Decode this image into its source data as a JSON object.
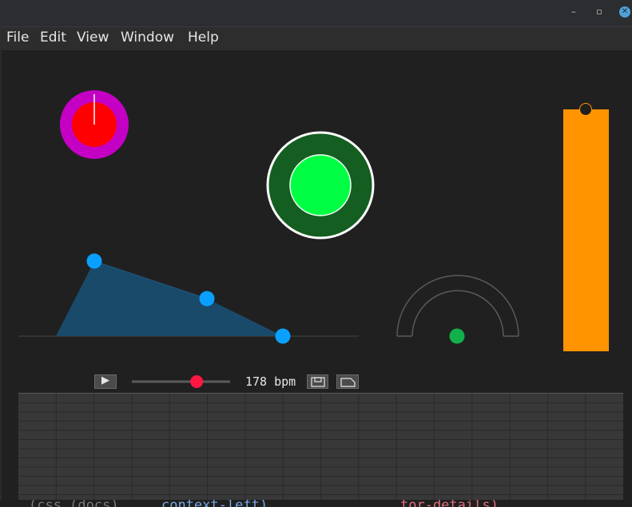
{
  "window": {
    "controls": {
      "minimize": "–",
      "maximize": "▫",
      "close": "✕"
    }
  },
  "menu": {
    "items": [
      "File",
      "Edit",
      "View",
      "Window",
      "Help"
    ]
  },
  "transport": {
    "play_glyph": "▶",
    "tempo_label": "178 bpm",
    "tempo_slider_fraction": 0.66
  },
  "colors": {
    "knob_outer": "#c400c4",
    "knob_inner": "#ff0000",
    "button_ring": "#135e20",
    "button_fill": "#00ff44",
    "envelope_fill": "#1a4a6a",
    "envelope_point": "#0aa0ff",
    "arc_stroke": "#5a5a5a",
    "arc_point": "#12b04a",
    "fader_fill": "#ff9400",
    "slider_thumb": "#ff1744",
    "grid_bg": "#383838",
    "grid_line": "#2a2a2a"
  },
  "sequencer": {
    "columns": 16,
    "rows": 12
  },
  "code_fragments": [
    "(css (docs)",
    "context-left)",
    "tor-details)"
  ]
}
